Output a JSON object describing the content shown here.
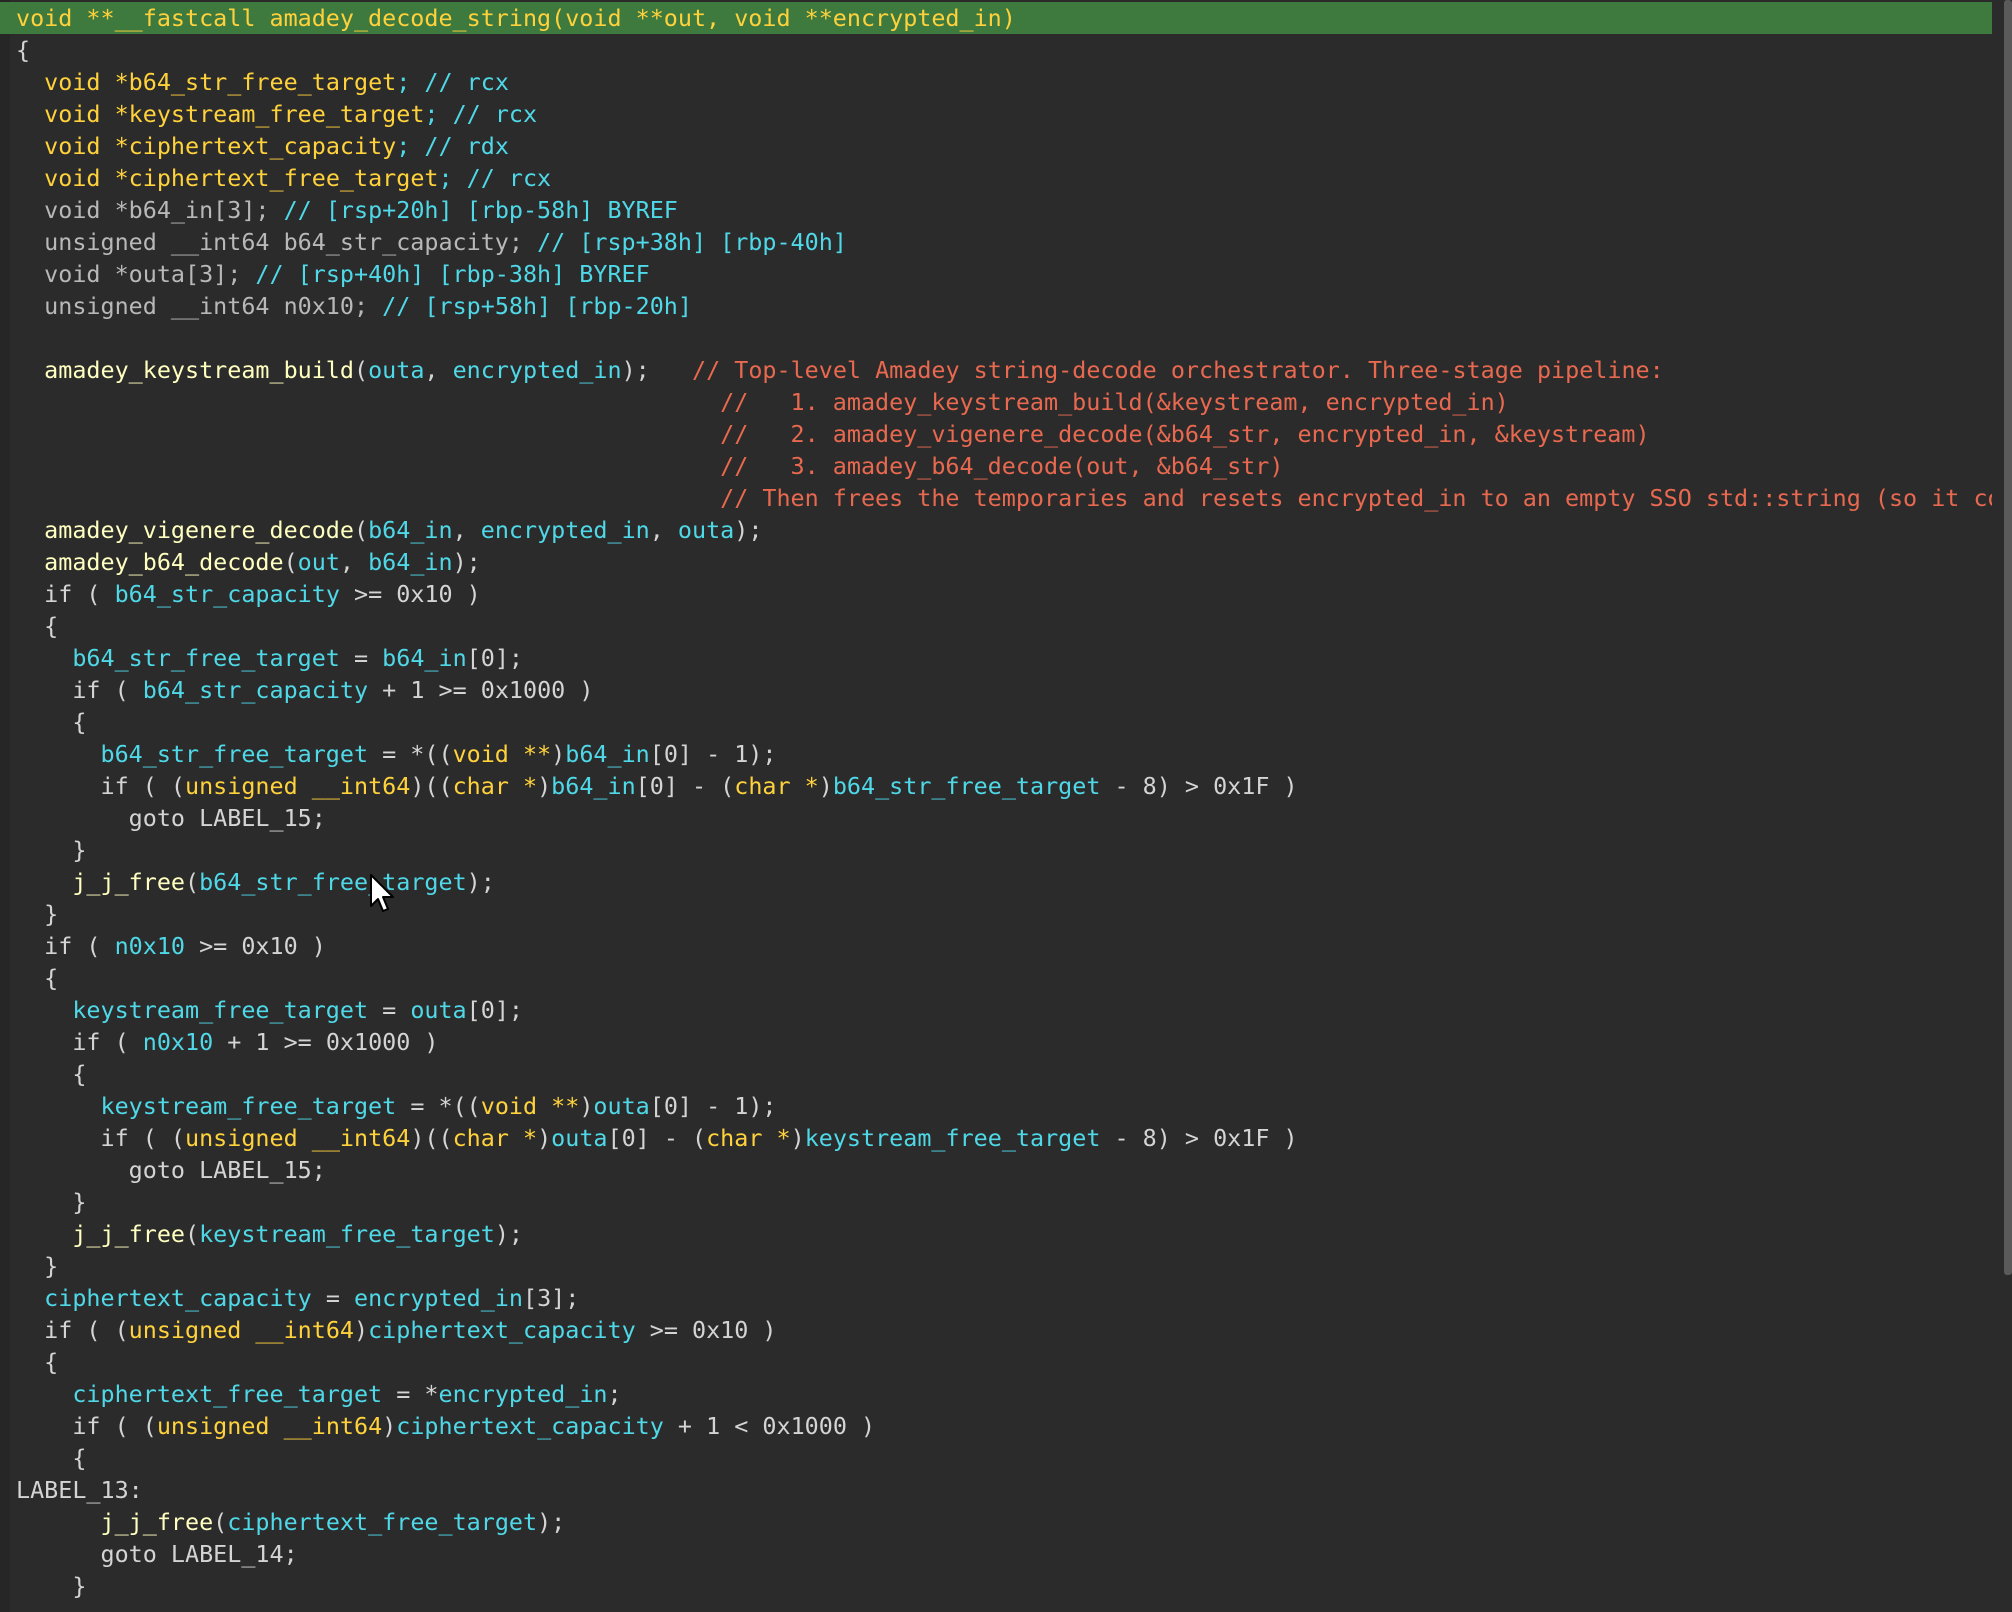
{
  "code": {
    "lines": [
      [
        {
          "t": "void **__fastcall amadey_decode_string(void **out, void **encrypted_in)",
          "c": "kw"
        }
      ],
      [
        {
          "t": "{",
          "c": "pl"
        }
      ],
      [
        {
          "t": "  void *",
          "c": "kw"
        },
        {
          "t": "b64_str_free_target",
          "c": "kw"
        },
        {
          "t": "; // rcx",
          "c": "var"
        }
      ],
      [
        {
          "t": "  void *",
          "c": "kw"
        },
        {
          "t": "keystream_free_target",
          "c": "kw"
        },
        {
          "t": "; // rcx",
          "c": "var"
        }
      ],
      [
        {
          "t": "  void *",
          "c": "kw"
        },
        {
          "t": "ciphertext_capacity",
          "c": "kw"
        },
        {
          "t": "; // rdx",
          "c": "var"
        }
      ],
      [
        {
          "t": "  void *",
          "c": "kw"
        },
        {
          "t": "ciphertext_free_target",
          "c": "kw"
        },
        {
          "t": "; // rcx",
          "c": "var"
        }
      ],
      [
        {
          "t": "  void *b64_in[3]; ",
          "c": "dim"
        },
        {
          "t": "// [rsp+20h] [rbp-58h] BYREF",
          "c": "var"
        }
      ],
      [
        {
          "t": "  unsigned __int64 b64_str_capacity; ",
          "c": "dim"
        },
        {
          "t": "// [rsp+38h] [rbp-40h]",
          "c": "var"
        }
      ],
      [
        {
          "t": "  void *outa[3]; ",
          "c": "dim"
        },
        {
          "t": "// [rsp+40h] [rbp-38h] BYREF",
          "c": "var"
        }
      ],
      [
        {
          "t": "  unsigned __int64 n0x10; ",
          "c": "dim"
        },
        {
          "t": "// [rsp+58h] [rbp-20h]",
          "c": "var"
        }
      ],
      [
        {
          "t": "",
          "c": "pl"
        }
      ],
      [
        {
          "t": "  amadey_keystream_build",
          "c": "fn"
        },
        {
          "t": "(",
          "c": "pl"
        },
        {
          "t": "outa",
          "c": "var"
        },
        {
          "t": ", ",
          "c": "pl"
        },
        {
          "t": "encrypted_in",
          "c": "var"
        },
        {
          "t": ");   ",
          "c": "pl"
        },
        {
          "t": "// Top-level Amadey string-decode orchestrator. Three-stage pipeline:",
          "c": "cm"
        }
      ],
      [
        {
          "t": "                                                  //   1. amadey_keystream_build(&keystream, encrypted_in)",
          "c": "cm"
        }
      ],
      [
        {
          "t": "                                                  //   2. amadey_vigenere_decode(&b64_str, encrypted_in, &keystream)",
          "c": "cm"
        }
      ],
      [
        {
          "t": "                                                  //   3. amadey_b64_decode(out, &b64_str)",
          "c": "cm"
        }
      ],
      [
        {
          "t": "                                                  // Then frees the temporaries and resets encrypted_in to an empty SSO std::string (so it co",
          "c": "cm"
        }
      ],
      [
        {
          "t": "  amadey_vigenere_decode",
          "c": "fn"
        },
        {
          "t": "(",
          "c": "pl"
        },
        {
          "t": "b64_in",
          "c": "var"
        },
        {
          "t": ", ",
          "c": "pl"
        },
        {
          "t": "encrypted_in",
          "c": "var"
        },
        {
          "t": ", ",
          "c": "pl"
        },
        {
          "t": "outa",
          "c": "var"
        },
        {
          "t": ");",
          "c": "pl"
        }
      ],
      [
        {
          "t": "  amadey_b64_decode",
          "c": "fn"
        },
        {
          "t": "(",
          "c": "pl"
        },
        {
          "t": "out",
          "c": "var"
        },
        {
          "t": ", ",
          "c": "pl"
        },
        {
          "t": "b64_in",
          "c": "var"
        },
        {
          "t": ");",
          "c": "pl"
        }
      ],
      [
        {
          "t": "  if ( ",
          "c": "pl"
        },
        {
          "t": "b64_str_capacity",
          "c": "var"
        },
        {
          "t": " >= 0x10 )",
          "c": "pl"
        }
      ],
      [
        {
          "t": "  {",
          "c": "pl"
        }
      ],
      [
        {
          "t": "    b64_str_free_target",
          "c": "var"
        },
        {
          "t": " = ",
          "c": "pl"
        },
        {
          "t": "b64_in",
          "c": "var"
        },
        {
          "t": "[0];",
          "c": "pl"
        }
      ],
      [
        {
          "t": "    if ( ",
          "c": "pl"
        },
        {
          "t": "b64_str_capacity",
          "c": "var"
        },
        {
          "t": " + 1 >= 0x1000 )",
          "c": "pl"
        }
      ],
      [
        {
          "t": "    {",
          "c": "pl"
        }
      ],
      [
        {
          "t": "      b64_str_free_target",
          "c": "var"
        },
        {
          "t": " = *((",
          "c": "pl"
        },
        {
          "t": "void **",
          "c": "kw"
        },
        {
          "t": ")",
          "c": "pl"
        },
        {
          "t": "b64_in",
          "c": "var"
        },
        {
          "t": "[0] - 1);",
          "c": "pl"
        }
      ],
      [
        {
          "t": "      if ( (",
          "c": "pl"
        },
        {
          "t": "unsigned __int64",
          "c": "kw"
        },
        {
          "t": ")((",
          "c": "pl"
        },
        {
          "t": "char *",
          "c": "kw"
        },
        {
          "t": ")",
          "c": "pl"
        },
        {
          "t": "b64_in",
          "c": "var"
        },
        {
          "t": "[0] - (",
          "c": "pl"
        },
        {
          "t": "char *",
          "c": "kw"
        },
        {
          "t": ")",
          "c": "pl"
        },
        {
          "t": "b64_str_free_target",
          "c": "var"
        },
        {
          "t": " - 8) > 0x1F )",
          "c": "pl"
        }
      ],
      [
        {
          "t": "        goto LABEL_15;",
          "c": "pl"
        }
      ],
      [
        {
          "t": "    }",
          "c": "pl"
        }
      ],
      [
        {
          "t": "    j_j_free",
          "c": "fn"
        },
        {
          "t": "(",
          "c": "pl"
        },
        {
          "t": "b64_str_free_target",
          "c": "var"
        },
        {
          "t": ");",
          "c": "pl"
        }
      ],
      [
        {
          "t": "  }",
          "c": "pl"
        }
      ],
      [
        {
          "t": "  if ( ",
          "c": "pl"
        },
        {
          "t": "n0x10",
          "c": "var"
        },
        {
          "t": " >= 0x10 )",
          "c": "pl"
        }
      ],
      [
        {
          "t": "  {",
          "c": "pl"
        }
      ],
      [
        {
          "t": "    keystream_free_target",
          "c": "var"
        },
        {
          "t": " = ",
          "c": "pl"
        },
        {
          "t": "outa",
          "c": "var"
        },
        {
          "t": "[0];",
          "c": "pl"
        }
      ],
      [
        {
          "t": "    if ( ",
          "c": "pl"
        },
        {
          "t": "n0x10",
          "c": "var"
        },
        {
          "t": " + 1 >= 0x1000 )",
          "c": "pl"
        }
      ],
      [
        {
          "t": "    {",
          "c": "pl"
        }
      ],
      [
        {
          "t": "      keystream_free_target",
          "c": "var"
        },
        {
          "t": " = *((",
          "c": "pl"
        },
        {
          "t": "void **",
          "c": "kw"
        },
        {
          "t": ")",
          "c": "pl"
        },
        {
          "t": "outa",
          "c": "var"
        },
        {
          "t": "[0] - 1);",
          "c": "pl"
        }
      ],
      [
        {
          "t": "      if ( (",
          "c": "pl"
        },
        {
          "t": "unsigned __int64",
          "c": "kw"
        },
        {
          "t": ")((",
          "c": "pl"
        },
        {
          "t": "char *",
          "c": "kw"
        },
        {
          "t": ")",
          "c": "pl"
        },
        {
          "t": "outa",
          "c": "var"
        },
        {
          "t": "[0] - (",
          "c": "pl"
        },
        {
          "t": "char *",
          "c": "kw"
        },
        {
          "t": ")",
          "c": "pl"
        },
        {
          "t": "keystream_free_target",
          "c": "var"
        },
        {
          "t": " - 8) > 0x1F )",
          "c": "pl"
        }
      ],
      [
        {
          "t": "        goto LABEL_15;",
          "c": "pl"
        }
      ],
      [
        {
          "t": "    }",
          "c": "pl"
        }
      ],
      [
        {
          "t": "    j_j_free",
          "c": "fn"
        },
        {
          "t": "(",
          "c": "pl"
        },
        {
          "t": "keystream_free_target",
          "c": "var"
        },
        {
          "t": ");",
          "c": "pl"
        }
      ],
      [
        {
          "t": "  }",
          "c": "pl"
        }
      ],
      [
        {
          "t": "  ciphertext_capacity",
          "c": "var"
        },
        {
          "t": " = ",
          "c": "pl"
        },
        {
          "t": "encrypted_in",
          "c": "var"
        },
        {
          "t": "[3];",
          "c": "pl"
        }
      ],
      [
        {
          "t": "  if ( (",
          "c": "pl"
        },
        {
          "t": "unsigned __int64",
          "c": "kw"
        },
        {
          "t": ")",
          "c": "pl"
        },
        {
          "t": "ciphertext_capacity",
          "c": "var"
        },
        {
          "t": " >= 0x10 )",
          "c": "pl"
        }
      ],
      [
        {
          "t": "  {",
          "c": "pl"
        }
      ],
      [
        {
          "t": "    ciphertext_free_target",
          "c": "var"
        },
        {
          "t": " = *",
          "c": "pl"
        },
        {
          "t": "encrypted_in",
          "c": "var"
        },
        {
          "t": ";",
          "c": "pl"
        }
      ],
      [
        {
          "t": "    if ( (",
          "c": "pl"
        },
        {
          "t": "unsigned __int64",
          "c": "kw"
        },
        {
          "t": ")",
          "c": "pl"
        },
        {
          "t": "ciphertext_capacity",
          "c": "var"
        },
        {
          "t": " + 1 < 0x1000 )",
          "c": "pl"
        }
      ],
      [
        {
          "t": "    {",
          "c": "pl"
        }
      ],
      [
        {
          "t": "LABEL_13:",
          "c": "pl"
        }
      ],
      [
        {
          "t": "      j_j_free",
          "c": "fn"
        },
        {
          "t": "(",
          "c": "pl"
        },
        {
          "t": "ciphertext_free_target",
          "c": "var"
        },
        {
          "t": ");",
          "c": "pl"
        }
      ],
      [
        {
          "t": "      goto LABEL_14;",
          "c": "pl"
        }
      ],
      [
        {
          "t": "    }",
          "c": "pl"
        }
      ]
    ]
  },
  "colors": {
    "background": "#2b2b2b",
    "highlight_line": "#3e7a3e",
    "keyword": "#ffd23c",
    "variable": "#4fd9e8",
    "function": "#ffffc0",
    "comment": "#e8694f",
    "plain": "#d4d4d4"
  },
  "cursor": {
    "icon": "mouse-pointer-icon"
  }
}
